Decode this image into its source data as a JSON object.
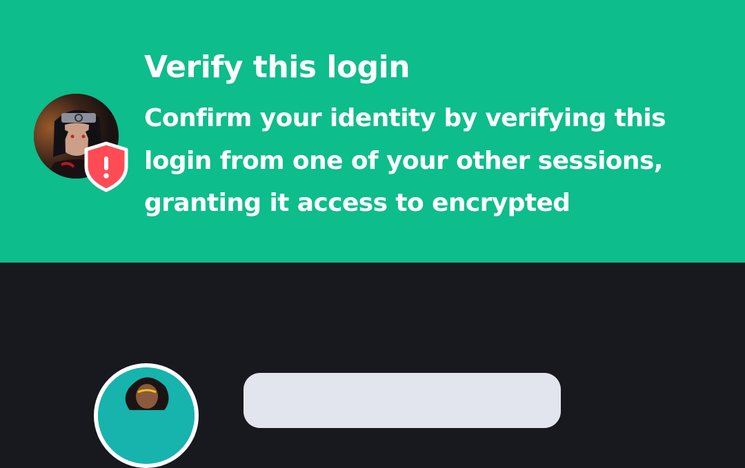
{
  "banner": {
    "title": "Verify this login",
    "body_lines": [
      "Confirm your identity by verifying this",
      "login from one of your other sessions,",
      "granting it access to encrypted"
    ],
    "background_color": "#0dbd8b",
    "avatar_icon": "user-avatar",
    "badge_icon": "shield-warning-icon",
    "badge_color": "#ff4b55"
  },
  "page": {
    "background_color": "#17191e"
  },
  "room_list": {
    "avatar_icon": "room-avatar",
    "bubble_color": "#e3e5ee"
  }
}
